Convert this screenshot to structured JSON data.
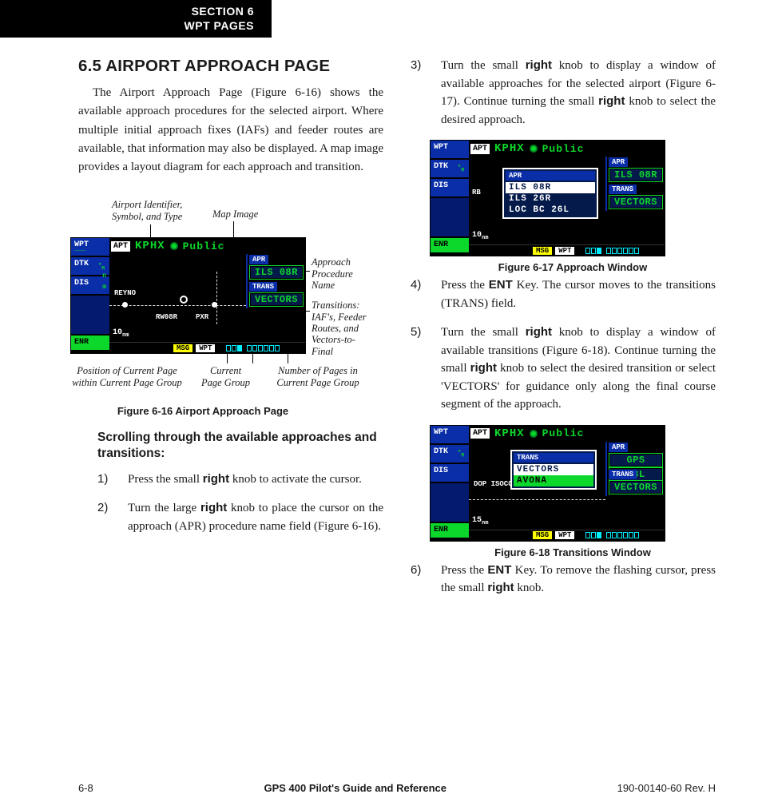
{
  "tab": {
    "line1": "SECTION 6",
    "line2": "WPT PAGES"
  },
  "section_title": "6.5  AIRPORT APPROACH PAGE",
  "intro": "The Airport Approach Page (Figure 6-16) shows the available approach procedures for the selected airport. Where multiple initial approach fixes (IAFs) and feeder routes are available, that information may also be displayed.  A map image provides a layout diagram for each approach and transition.",
  "fig16": {
    "top_callouts": {
      "left": "Airport Identifier,\nSymbol, and Type",
      "right": "Map Image"
    },
    "right_callouts": {
      "apr": "Approach\nProcedure\nName",
      "trans": "Transitions:\nIAF's, Feeder\nRoutes, and\nVectors-to-Final"
    },
    "bottom_callouts": {
      "pos": "Position of Current Page\nwithin Current Page Group",
      "group": "Current\nPage Group",
      "count": "Number of Pages in\nCurrent Page Group"
    },
    "caption": "Figure 6-16  Airport Approach Page",
    "gps": {
      "side": [
        "WPT",
        "DTK",
        "DIS",
        "ENR"
      ],
      "apt": "APT",
      "ident": "KPHX",
      "type": "Public",
      "apr_label": "APR",
      "apr_value": "ILS 08R",
      "trans_label": "TRANS",
      "trans_value": "VECTORS",
      "map": {
        "reyno": "REYNO",
        "rw": "RW08R",
        "pxr": "PXR",
        "scale": "10",
        "scale_unit": "nm"
      },
      "msg": "MSG",
      "wpt": "WPT"
    }
  },
  "instr_head": "Scrolling through the available approaches and transitions:",
  "steps_left": [
    {
      "n": "1)",
      "t": "Press the small <b>right</b> knob to activate the cursor."
    },
    {
      "n": "2)",
      "t": "Turn the large <b>right</b> knob to place the cursor on the approach (APR) procedure name field (Figure 6-16)."
    }
  ],
  "steps_right_top": [
    {
      "n": "3)",
      "t": "Turn the small <b>right</b> knob to display a window of available approaches for the selected airport (Figure 6-17).  Continue turning the small <b>right</b> knob to select the desired approach."
    }
  ],
  "fig17": {
    "caption": "Figure 6-17  Approach Window",
    "gps": {
      "side": [
        "WPT",
        "DTK",
        "DIS",
        "ENR"
      ],
      "apt": "APT",
      "ident": "KPHX",
      "type": "Public",
      "apr_label": "APR",
      "apr_value": "ILS 08R",
      "trans_label": "TRANS",
      "trans_value": "VECTORS",
      "scale": "10",
      "scale_unit": "nm",
      "msg": "MSG",
      "wpt": "WPT",
      "rb": "RB"
    },
    "popup": {
      "h": "APR",
      "items": [
        "ILS 08R",
        "ILS 26R",
        "LOC BC 26L"
      ],
      "sel": 0
    }
  },
  "steps_right_mid": [
    {
      "n": "4)",
      "t": "Press the <b>ENT</b> Key.  The cursor moves to the transitions (TRANS) field."
    },
    {
      "n": "5)",
      "t": "Turn the small <b>right</b> knob to display a window of available transitions (Figure 6-18).  Continue turning the small <b>right</b> knob to select the desired transition or select 'VECTORS' for guidance only along the final course segment of the approach."
    }
  ],
  "fig18": {
    "caption": "Figure 6-18  Transitions Window",
    "gps": {
      "side": [
        "WPT",
        "DTK",
        "DIS",
        "ENR"
      ],
      "apt": "APT",
      "ident": "KPHX",
      "type": "Public",
      "apr_label": "APR",
      "apr_value_a": "GPS",
      "apr_value_b": "08L",
      "trans_label": "TRANS",
      "trans_value": "VECTORS",
      "scale": "15",
      "scale_unit": "nm",
      "msg": "MSG",
      "wpt": "WPT",
      "map_txt": "DOP ISOCO"
    },
    "popup": {
      "h": "TRANS",
      "items": [
        "VECTORS",
        "AVONA"
      ],
      "sel": 0,
      "cursor": 1
    }
  },
  "steps_right_end": [
    {
      "n": "6)",
      "t": "Press the <b>ENT</b> Key.  To remove the flashing cursor, press the small <b>right</b> knob."
    }
  ],
  "footer": {
    "page": "6-8",
    "title": "GPS 400 Pilot's Guide and Reference",
    "rev": "190-00140-60  Rev. H"
  }
}
